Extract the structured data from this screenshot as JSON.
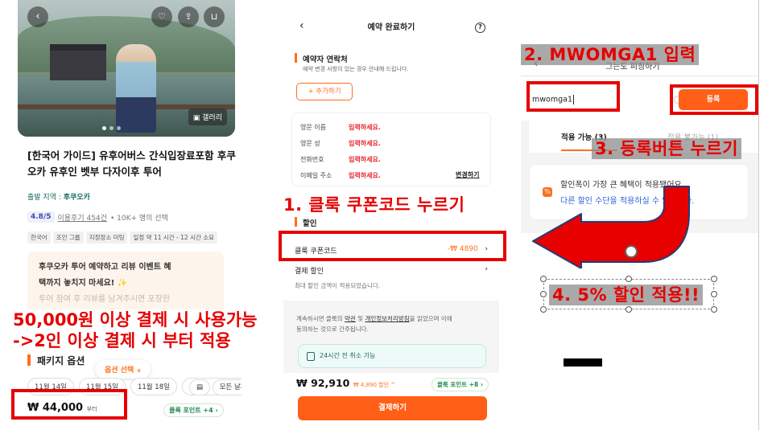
{
  "left_panel": {
    "gallery_label": "갤러리",
    "title": "[한국어 가이드] 유후어버스 간식입장료포함 후쿠오카 유후인 벳부 다자이후 투어",
    "region_label": "출발 지역 :",
    "region_value": "후쿠오카",
    "rating_score": "4.8/5",
    "review_link": "이용후기 454건",
    "booked": "10K+ 명의 선택",
    "tags": [
      "한국어",
      "조인 그룹",
      "지정장소 미팅",
      "일정 약 11 시간 - 12 시간 소요"
    ],
    "promo_line1": "후쿠오카 투어 예약하고 리뷰 이벤트 혜",
    "promo_line2": "택까지 놓치지 마세요!",
    "promo_line2_icon": "✨",
    "promo_line3": "투어 참여 후 리뷰를 남겨주시면 포장한",
    "package_title": "패키지 옵션",
    "option_select": "옵션 선택",
    "option_select_icon": "»",
    "dates": [
      "11월 14일",
      "11월 15일",
      "11월 18일",
      "모든 날짜"
    ],
    "price": "₩ 44,000",
    "price_suffix": "부터",
    "point": "클룩 포인트 +4"
  },
  "middle_panel": {
    "header": "예약 완료하기",
    "back_icon": "‹",
    "help_icon": "?",
    "contact_title": "예약자 연락처",
    "contact_sub": "예약 변경 사항이 있는 경우 안내해 드립니다.",
    "add_button": "+ 추가하기",
    "contact_rows": [
      {
        "label": "영문 이름",
        "value": "입력하세요."
      },
      {
        "label": "영문 성",
        "value": "입력하세요."
      },
      {
        "label": "전화번호",
        "value": "입력하세요."
      },
      {
        "label": "이메일 주소",
        "value": "입력하세요."
      }
    ],
    "edit_link": "변경하기",
    "discount_title": "할인",
    "coupon_label": "클룩 쿠폰코드",
    "coupon_amount": "-₩ 4890",
    "chevron": "›",
    "payment_discount": "결제 할인",
    "payment_discount_sub": "최대 할인 금액이 적용되었습니다.",
    "terms_line1_a": "계속하시면 클룩의 ",
    "terms_terms": "약관",
    "terms_line1_b": " 및 ",
    "terms_privacy": "개인정보처리방침",
    "terms_line1_c": "을 읽었으며 이에",
    "terms_line2": "동의하는 것으로 간주됩니다.",
    "cancel_badge": "24시간 전 취소 가능",
    "total": "₩ 92,910",
    "total_discount": "₩ 4,890 할인 ^",
    "point": "클룩 포인트 +8",
    "pay_button": "결제하기"
  },
  "right_panel": {
    "back_icon": "‹",
    "header_partial": "그는도 피칭하기",
    "code_value": "mwomga1",
    "register_button": "등록",
    "tab_available": "적용 가능 (3)",
    "tab_unavailable": "적용 불가능 (1)",
    "info_icon": "%",
    "info_line1": "할인폭이 가장 큰 혜택이 적용됐어요.",
    "info_line2": "다른 할인 수단을 적용하실 수 있습니다."
  },
  "annotations": {
    "step1": "1. 클룩 쿠폰코드 누르기",
    "step2": "2. MWOMGA1 입력",
    "step3": "3. 등록버튼 누르기",
    "step4": "4. 5% 할인 적용!!",
    "note_line1": "50,000원 이상 결제 시 사용가능",
    "note_line2": "->2인 이상 결제 시 부터 적용",
    "highlight_color": "#e60000",
    "accent_color": "#ff5f16"
  }
}
